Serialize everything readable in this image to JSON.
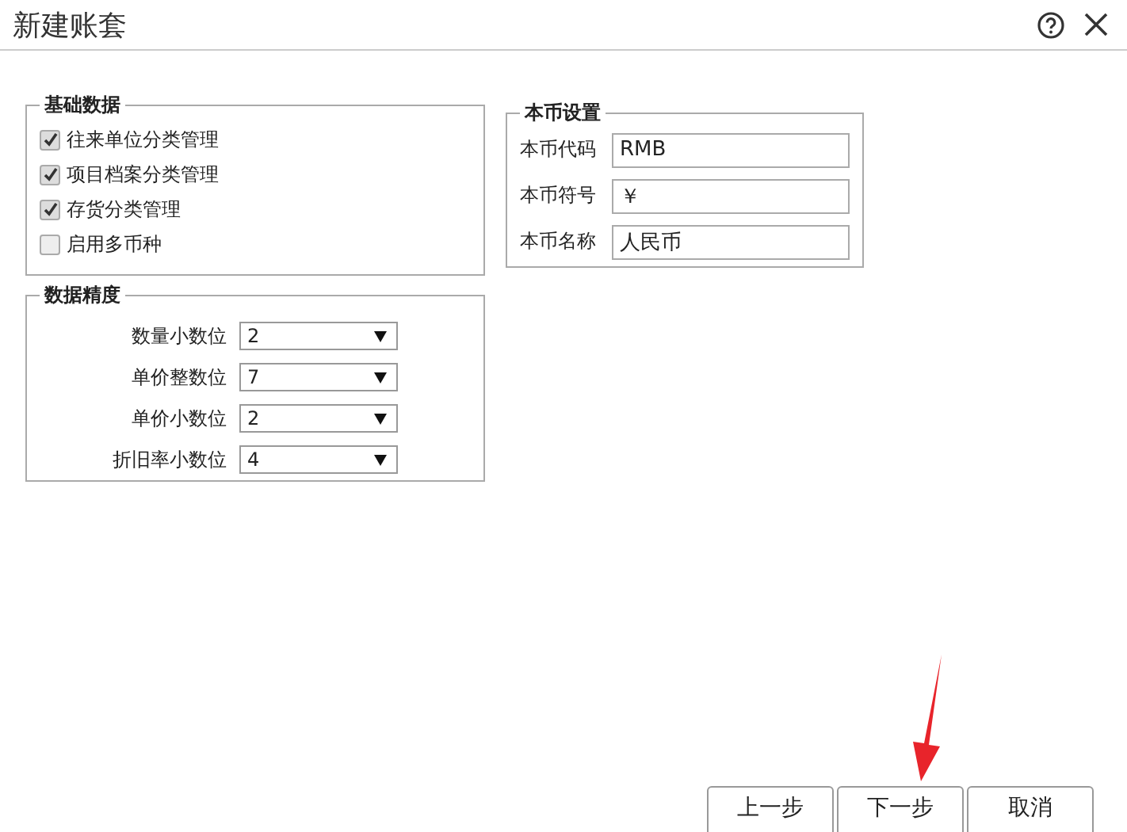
{
  "window": {
    "title": "新建账套"
  },
  "basic_data": {
    "title": "基础数据",
    "options": [
      {
        "label": "往来单位分类管理",
        "checked": true
      },
      {
        "label": "项目档案分类管理",
        "checked": true
      },
      {
        "label": "存货分类管理",
        "checked": true
      },
      {
        "label": "启用多币种",
        "checked": false
      }
    ]
  },
  "precision": {
    "title": "数据精度",
    "fields": [
      {
        "label": "数量小数位",
        "value": "2"
      },
      {
        "label": "单价整数位",
        "value": "7"
      },
      {
        "label": "单价小数位",
        "value": "2"
      },
      {
        "label": "折旧率小数位",
        "value": "4"
      }
    ]
  },
  "currency": {
    "title": "本币设置",
    "fields": [
      {
        "label": "本币代码",
        "value": "RMB"
      },
      {
        "label": "本币符号",
        "value": "￥"
      },
      {
        "label": "本币名称",
        "value": "人民币"
      }
    ]
  },
  "buttons": [
    {
      "label": "上一步"
    },
    {
      "label": "下一步"
    },
    {
      "label": "取消"
    }
  ]
}
